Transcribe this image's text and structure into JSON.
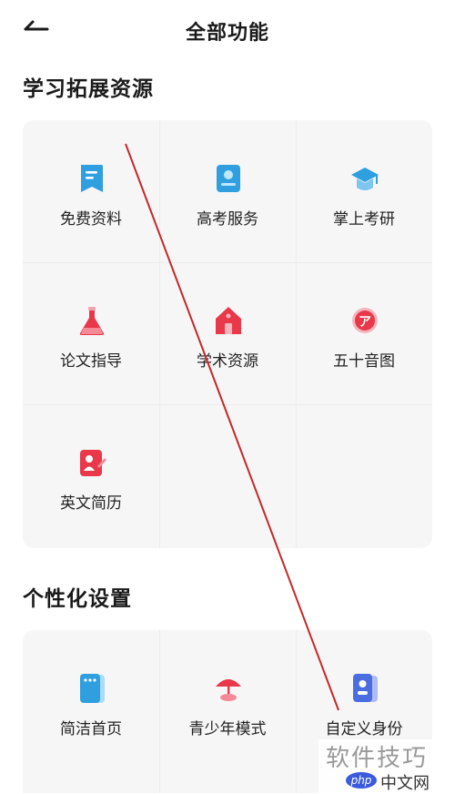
{
  "header": {
    "title": "全部功能",
    "back_icon": "back-arrow-icon"
  },
  "sections": [
    {
      "title": "学习拓展资源",
      "items": [
        {
          "label": "免费资料",
          "icon": "bookmark-doc-icon",
          "color": "#2f9fe0"
        },
        {
          "label": "高考服务",
          "icon": "exam-card-icon",
          "color": "#2f9fe0"
        },
        {
          "label": "掌上考研",
          "icon": "graduation-cap-icon",
          "color": "#2f9fe0"
        },
        {
          "label": "论文指导",
          "icon": "flask-icon",
          "color": "#e8384a"
        },
        {
          "label": "学术资源",
          "icon": "house-icon",
          "color": "#e8384a"
        },
        {
          "label": "五十音图",
          "icon": "kana-badge-icon",
          "color": "#e8384a"
        },
        {
          "label": "英文简历",
          "icon": "resume-icon",
          "color": "#e8384a"
        }
      ]
    },
    {
      "title": "个性化设置",
      "items": [
        {
          "label": "简洁首页",
          "icon": "phone-grid-icon",
          "color": "#2f9fe0"
        },
        {
          "label": "青少年模式",
          "icon": "umbrella-icon",
          "color": "#e8384a"
        },
        {
          "label": "自定义身份",
          "icon": "id-card-icon",
          "color": "#4a6ee0"
        }
      ]
    }
  ],
  "watermark": {
    "text": "软件技巧",
    "badge": "php",
    "site": "中文网"
  },
  "annotation_color": "#c62828"
}
